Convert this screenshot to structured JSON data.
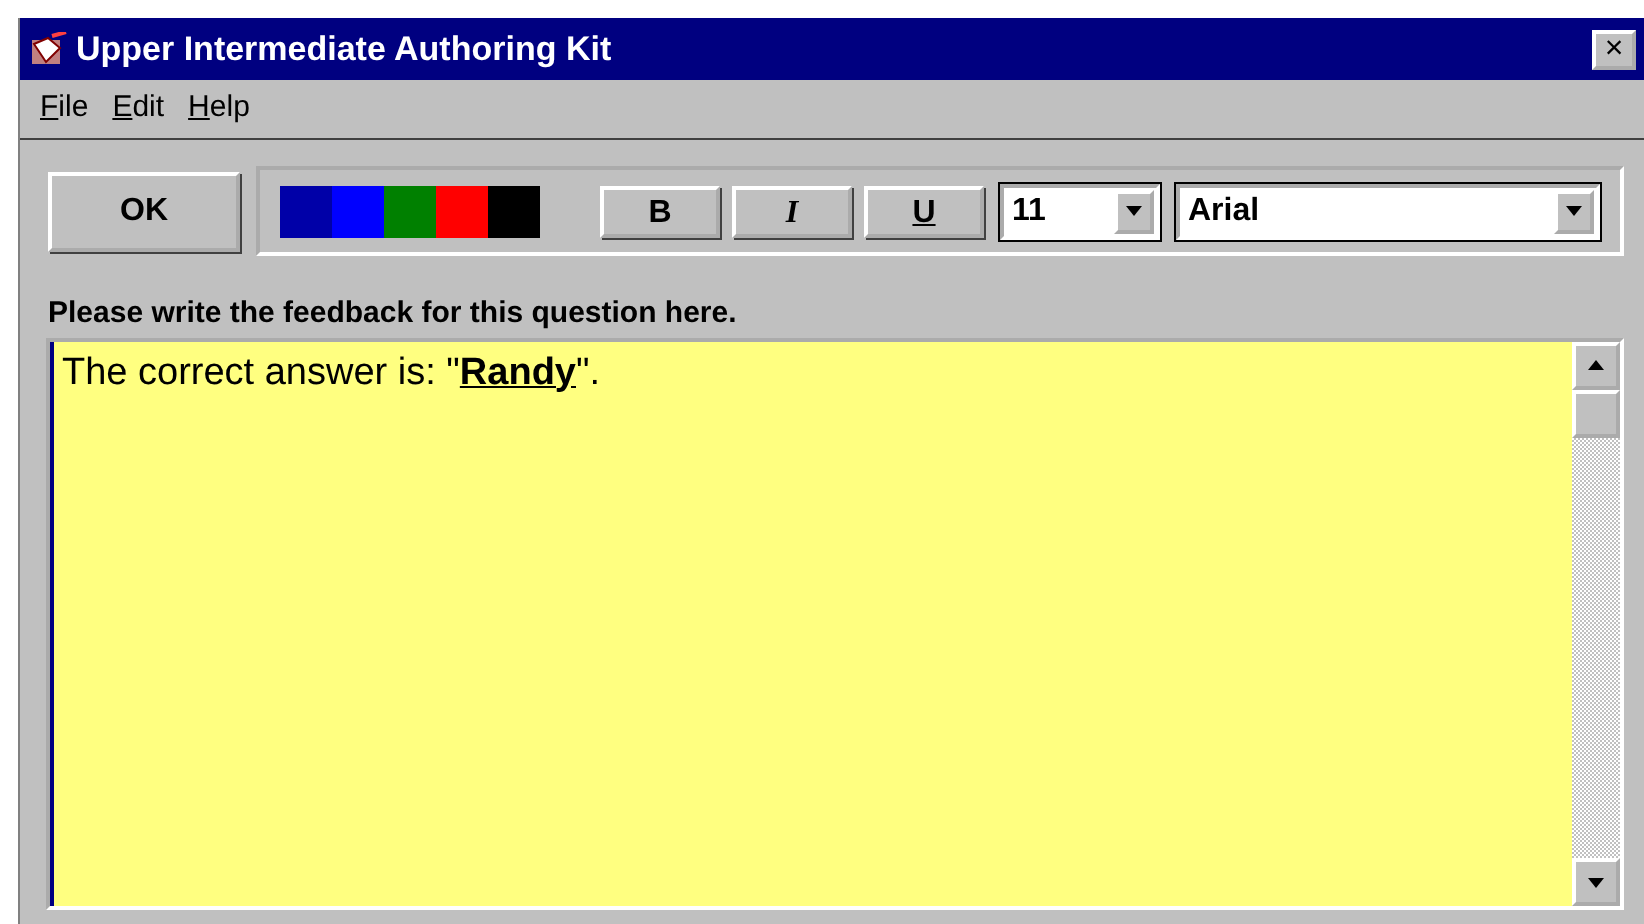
{
  "window": {
    "title": "Upper Intermediate Authoring Kit",
    "close": "×"
  },
  "menu": [
    "File",
    "Edit",
    "Help"
  ],
  "toolbar": {
    "ok": "OK",
    "colors": [
      {
        "color": "#0000a8"
      },
      {
        "color": "#0000ff"
      },
      {
        "color": "#008000"
      },
      {
        "color": "#ff0000"
      },
      {
        "color": "#000000"
      }
    ],
    "format_buttons": [
      {
        "kind": "bold",
        "label": "B"
      },
      {
        "kind": "italic",
        "label": "I"
      },
      {
        "kind": "underline",
        "label": "U"
      }
    ],
    "font_size": "11",
    "font_name": "Arial"
  },
  "prompt": "Please write the feedback for this question here.",
  "editor": {
    "text": "The correct answer is: \"**Randy**\"."
  }
}
